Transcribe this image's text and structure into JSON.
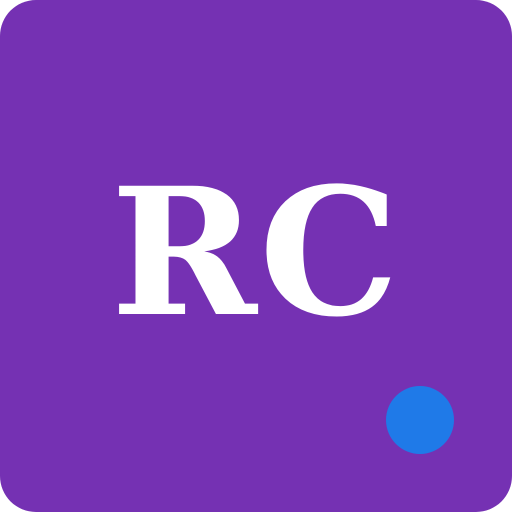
{
  "avatar": {
    "initials": "RC",
    "background_color": "#7531b3",
    "text_color": "#ffffff"
  },
  "status_indicator": {
    "color": "#1f7ae8"
  }
}
